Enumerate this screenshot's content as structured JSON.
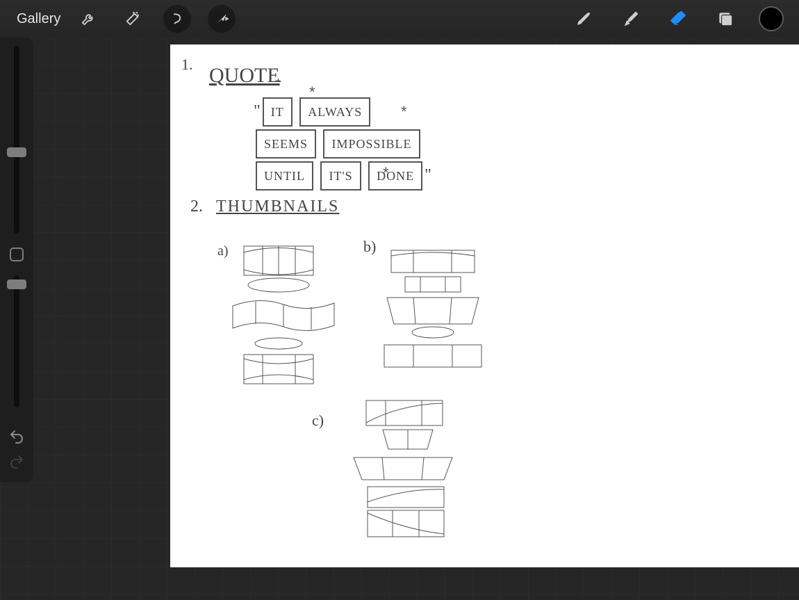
{
  "app": "Procreate",
  "toolbar": {
    "gallery_label": "Gallery",
    "active_tool": "eraser"
  },
  "sidebar": {
    "brush_size_pct": 55,
    "opacity_pct": 15
  },
  "colors": {
    "accent": "#1e8cff",
    "current_swatch": "#000000"
  },
  "canvas": {
    "section1": {
      "number": "1.",
      "heading": "QUOTE",
      "sep": "-",
      "open_quote": "\"",
      "words": [
        "IT",
        "ALWAYS",
        "SEEMS",
        "IMPOSSIBLE",
        "UNTIL",
        "IT'S",
        "DONE"
      ],
      "close_quote": "\"",
      "star": "*"
    },
    "section2": {
      "number": "2.",
      "heading": "THUMBNAILS",
      "options": {
        "a": "a)",
        "b": "b)",
        "c": "c)"
      }
    }
  }
}
